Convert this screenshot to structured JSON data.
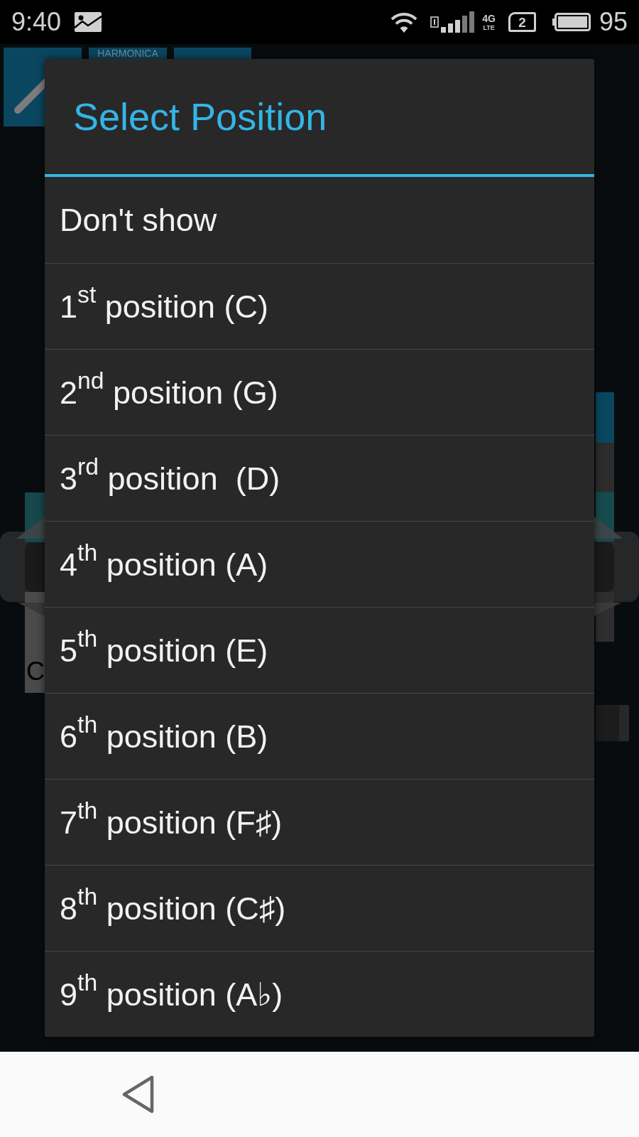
{
  "status_bar": {
    "time": "9:40",
    "network_type": "4G",
    "network_subtype": "LTE",
    "sim_slot": "2",
    "battery_percent": "95"
  },
  "background": {
    "tile_label": "HARMONICA",
    "key_label": "C"
  },
  "dialog": {
    "title": "Select Position",
    "options": [
      "Don't show",
      "1$^{st}$ position (C)",
      "2$^{nd}$ position (G)",
      "3$^{rd}$ position  (D)",
      "4$^{th}$ position (A)",
      "5$^{th}$ position (E)",
      "6$^{th}$ position (B)",
      "7$^{th}$ position (F♯)",
      "8$^{th}$ position (C♯)",
      "9$^{th}$ position (A♭)"
    ]
  }
}
